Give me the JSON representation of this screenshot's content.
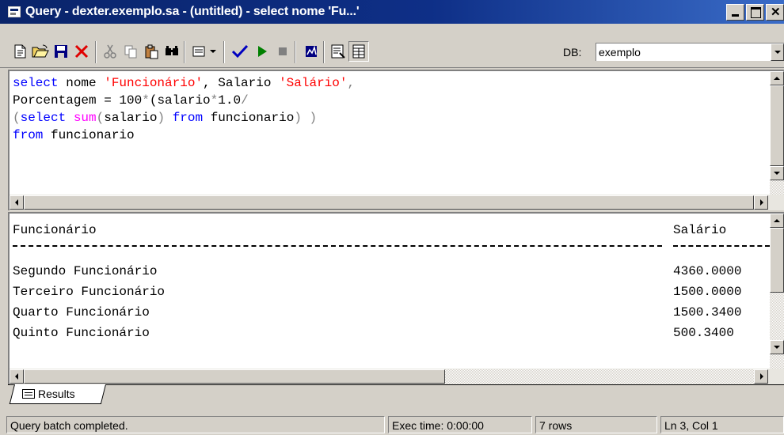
{
  "window": {
    "title": "Query - dexter.exemplo.sa - (untitled) - select nome 'Fu...'"
  },
  "toolbar": {
    "buttons": [
      "new-query-icon",
      "open-file-icon",
      "save-icon",
      "delete-icon",
      "cut-icon",
      "copy-icon",
      "paste-icon",
      "find-icon",
      "query-mode-icon",
      "dropdown-arrow-icon",
      "parse-query-icon",
      "execute-icon",
      "stop-icon",
      "show-plan-icon",
      "properties-icon",
      "results-grid-icon"
    ],
    "db_label": "DB:",
    "db_value": "exemplo"
  },
  "editor": {
    "lines": [
      "select nome 'Funcionário', Salario 'Salário',",
      "Porcentagem = 100*(salario*1.0/",
      "(select sum(salario) from funcionario) )",
      "from funcionario"
    ]
  },
  "results": {
    "header": {
      "col1": "Funcionário",
      "col2": "Salário"
    },
    "rows": [
      {
        "name": "Segundo Funcionário",
        "salary": "4360.0000"
      },
      {
        "name": "Terceiro Funcionário",
        "salary": "1500.0000"
      },
      {
        "name": "Quarto Funcionário",
        "salary": "1500.3400"
      },
      {
        "name": "Quinto Funcionário",
        "salary": "500.3400"
      }
    ]
  },
  "tabs": {
    "results_label": "Results"
  },
  "status": {
    "message": "Query batch completed.",
    "exec_time": "Exec time: 0:00:00",
    "rows": "7 rows",
    "position": "Ln 3, Col 1"
  },
  "colors": {
    "title_bar": "#0a246a",
    "keyword": "#0000ff",
    "string": "#ff0000",
    "function": "#ff00ff"
  }
}
